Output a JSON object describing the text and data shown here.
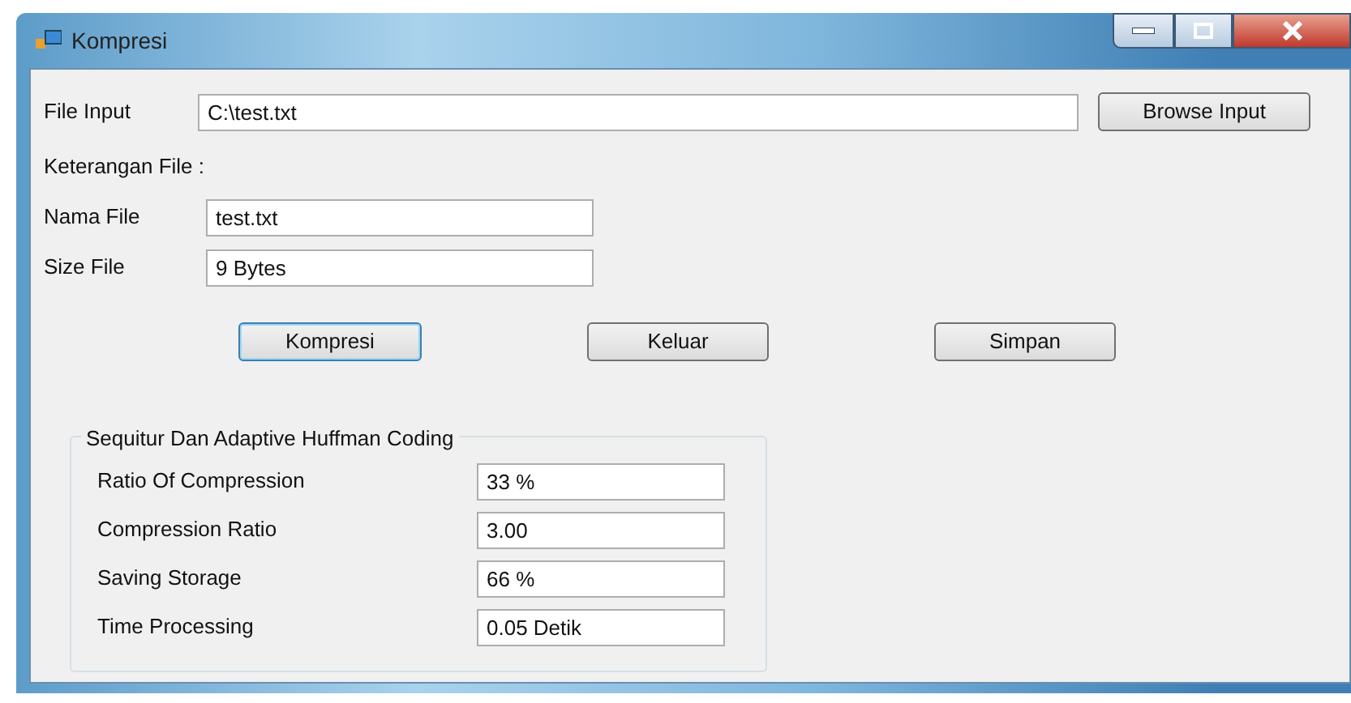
{
  "window": {
    "title": "Kompresi"
  },
  "file_input": {
    "label": "File Input",
    "value": "C:\\test.txt",
    "button": "Browse Input"
  },
  "file_info": {
    "heading": "Keterangan File :",
    "fields": [
      {
        "label": "Nama File",
        "value": "test.txt"
      },
      {
        "label": "Size File",
        "value": "9 Bytes"
      }
    ]
  },
  "buttons": [
    {
      "label": "Kompresi",
      "focused": true
    },
    {
      "label": "Keluar",
      "focused": false
    },
    {
      "label": "Simpan",
      "focused": false
    }
  ],
  "results": {
    "title": "Sequitur Dan Adaptive Huffman Coding",
    "fields": [
      {
        "label": "Ratio Of Compression",
        "value": "33 %"
      },
      {
        "label": "Compression Ratio",
        "value": "3.00"
      },
      {
        "label": "Saving Storage",
        "value": "66 %"
      },
      {
        "label": "Time Processing",
        "value": "0.05 Detik"
      }
    ]
  }
}
